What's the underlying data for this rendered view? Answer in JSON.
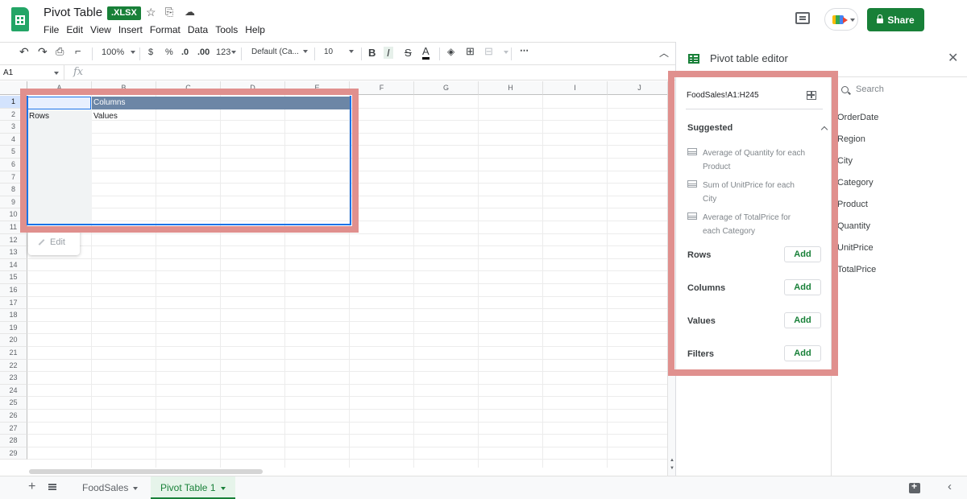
{
  "app": {
    "doc_title": "Pivot Table",
    "file_badge": ".XLSX",
    "menu": [
      "File",
      "Edit",
      "View",
      "Insert",
      "Format",
      "Data",
      "Tools",
      "Help"
    ],
    "share_label": "Share",
    "icons": [
      "star-icon",
      "move-to-folder-icon",
      "cloud-status-icon",
      "comment-icon",
      "meet-icon",
      "lock-icon"
    ]
  },
  "toolbar": {
    "zoom": "100%",
    "currency": "$",
    "percent": "%",
    "decimal_decrease": ".0",
    "decimal_increase": ".00",
    "number_format": "123",
    "font": "Default (Ca...",
    "font_size": "10",
    "bold": "B",
    "italic": "I",
    "strike": "S",
    "text_color": "A"
  },
  "formula_bar": {
    "cell_ref": "A1",
    "fx": "fx"
  },
  "grid": {
    "columns": [
      "A",
      "B",
      "C",
      "D",
      "E",
      "F",
      "G",
      "H",
      "I",
      "J"
    ],
    "rows": [
      "1",
      "2",
      "3",
      "4",
      "5",
      "6",
      "7",
      "8",
      "9",
      "10",
      "11",
      "12",
      "13",
      "14",
      "15",
      "16",
      "17",
      "18",
      "19",
      "20",
      "21",
      "22",
      "23",
      "24",
      "25",
      "26",
      "27",
      "28",
      "29"
    ],
    "pivot_columns_label": "Columns",
    "pivot_rows_label": "Rows",
    "pivot_values_label": "Values",
    "edit_chip": "Edit"
  },
  "sheets": {
    "tabs": [
      "FoodSales",
      "Pivot Table 1"
    ],
    "active": "Pivot Table 1"
  },
  "pivot_editor": {
    "title": "Pivot table editor",
    "range": "FoodSales!A1:H245",
    "suggested_label": "Suggested",
    "suggestions": [
      [
        "Average of Quantity for each",
        "Product"
      ],
      [
        "Sum of UnitPrice for each",
        "City"
      ],
      [
        "Average of TotalPrice for",
        "each Category"
      ]
    ],
    "sections": [
      "Rows",
      "Columns",
      "Values",
      "Filters"
    ],
    "add_label": "Add",
    "search_placeholder": "Search",
    "fields": [
      "OrderDate",
      "Region",
      "City",
      "Category",
      "Product",
      "Quantity",
      "UnitPrice",
      "TotalPrice"
    ]
  },
  "colors": {
    "brand_green": "#188038",
    "pivot_header": "#6c86a6",
    "selection_blue": "#1a73e8",
    "highlight": "#e0908e"
  }
}
